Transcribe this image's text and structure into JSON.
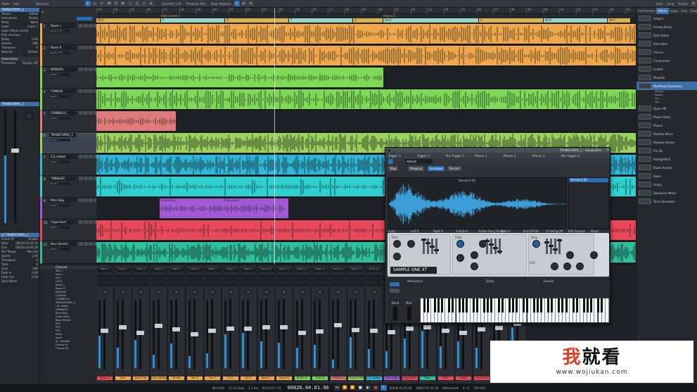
{
  "toolbar": {
    "mode": "Mute",
    "solo": "Solo",
    "standard": "Standard",
    "quantize": "Quantize",
    "timebase": "Timebase",
    "snap": "Snap",
    "quantize_val": "1/16",
    "timebase_val": "Bars",
    "snap_val": "Adaptive",
    "start": "Start",
    "song": "Song",
    "project": "Project"
  },
  "inspector": {
    "track_name": "TRANSFORM1_1",
    "rows": [
      {
        "k": "Tempo",
        "v": "Follow"
      },
      {
        "k": "Instrument",
        "v": "Drums"
      },
      {
        "k": "Mode",
        "v": "None"
      },
      {
        "k": "Layer",
        "v": "Layer 1"
      },
      {
        "k": "Layer follow events",
        "v": ""
      },
      {
        "k": "Play overlaps",
        "v": ""
      },
      {
        "k": "Delay",
        "v": "0.00"
      },
      {
        "k": "Volume",
        "v": "0dB"
      },
      {
        "k": "Transpose",
        "v": "0"
      },
      {
        "k": "Velocity",
        "v": "Default"
      }
    ],
    "automation_hdr": "Automation",
    "automation": "Parameter",
    "automation_val": "Display Off",
    "channel_name": "TRANSFORM1_1",
    "groups_hdr": "L1 TRANSFORM1_1",
    "groups": [
      {
        "k": "Event FX",
        "v": "Enable"
      },
      {
        "k": "Start",
        "v": "00026.02.01.25"
      },
      {
        "k": "End",
        "v": "00026.03.04.26"
      },
      {
        "k": "File Tempo",
        "v": "Not Set"
      },
      {
        "k": "Speed",
        "v": "1.00"
      },
      {
        "k": "Transpose",
        "v": "0"
      },
      {
        "k": "Tune",
        "v": "0"
      },
      {
        "k": "Gain",
        "v": "0dB"
      },
      {
        "k": "Fade In",
        "v": "0.00"
      },
      {
        "k": "Fade Out",
        "v": "0.00"
      },
      {
        "k": "Send Mode",
        "v": ""
      }
    ]
  },
  "ruler": [
    "13",
    "14",
    "15",
    "16",
    "17",
    "18",
    "19",
    "20",
    "21",
    "22",
    "23",
    "24",
    "25",
    "26",
    "27",
    "28",
    "29",
    "30",
    "31",
    "32",
    "33",
    "34",
    "35",
    "36",
    "37",
    "38",
    "39",
    "40",
    "41",
    "42",
    "43",
    "44",
    "45"
  ],
  "markers": [
    {
      "label": "Intro-Chord 1"
    },
    {
      "label": "Chorus 1"
    }
  ],
  "chords": [
    "Dm7",
    "F",
    "G",
    "F",
    "G",
    "Dm7",
    "G",
    "Am7",
    "Am7",
    "F",
    "G"
  ],
  "tracks": [
    {
      "num": "1",
      "name": "Room L",
      "input": "Input L+R",
      "color": "#f0a64a"
    },
    {
      "num": "2",
      "name": "Room R",
      "input": "Input L+R",
      "color": "#f0a64a"
    },
    {
      "num": "3",
      "name": "BONGOS",
      "input": "Input 1",
      "color": "#7ed957"
    },
    {
      "num": "4",
      "name": "CONGAS",
      "input": "Input 1",
      "color": "#7ed957"
    },
    {
      "num": "5",
      "name": "COWBELLS",
      "input": "Input 1",
      "color": "#e07b7b"
    },
    {
      "num": "6",
      "name": "TRANSFORM1_1",
      "input": "Input 1",
      "color": "#9bd35e"
    },
    {
      "num": "7",
      "name": "L1L shaker",
      "input": "Input 1",
      "color": "#2fb6d8"
    },
    {
      "num": "8",
      "name": "TIMBALES",
      "input": "Input 1",
      "color": "#2fd0d0"
    },
    {
      "num": "9",
      "name": "Rhm Slap",
      "input": "Input 1",
      "color": "#a15ad4"
    },
    {
      "num": "10",
      "name": "Claps Hard",
      "input": "Input 1",
      "color": "#e8485a"
    },
    {
      "num": "11",
      "name": "Bass Electric",
      "input": "Input 1",
      "color": "#2fbf9c"
    }
  ],
  "clip_labels": [
    "Percussion",
    "Percussion"
  ],
  "mixer": {
    "channel_hdr": "Channel",
    "list": [
      "Tom 1",
      "Tom 2",
      "OH L",
      "OH R",
      "Room L",
      "Room R",
      "BONGOS",
      "CONGAS",
      "COWBELLS",
      "TRANSFORM1_1",
      "L1L shaker",
      "TIMBALES",
      "Rhm Slap",
      "Claps Hard",
      "Bass Electric",
      "EP4",
      "EP2",
      "EP3",
      "Mello",
      "Vocal",
      "VL. sforzato",
      "Chorus VI",
      "Chorus VII"
    ],
    "strips": [
      {
        "io": "Input 1",
        "label": "Drum 1",
        "color": "#e8485a",
        "fader": 0.55,
        "meter": 0.48
      },
      {
        "io": "Input 2",
        "label": "Kick",
        "color": "#f0a64a",
        "fader": 0.6,
        "meter": 0.3
      },
      {
        "io": "Input 3",
        "label": "Snare Top",
        "color": "#f0a64a",
        "fader": 0.52,
        "meter": 0.42
      },
      {
        "io": "Input 4",
        "label": "Snare Bottom",
        "color": "#f0a64a",
        "fader": 0.62,
        "meter": 0.2
      },
      {
        "io": "Input 5",
        "label": "Hi-Hat",
        "color": "#f0a64a",
        "fader": 0.57,
        "meter": 0.36
      },
      {
        "io": "Input 6",
        "label": "Tom 1",
        "color": "#f0a64a",
        "fader": 0.5,
        "meter": 0.18
      },
      {
        "io": "Input 7",
        "label": "Tom 2",
        "color": "#f0a64a",
        "fader": 0.55,
        "meter": 0.22
      },
      {
        "io": "Input 8",
        "label": "OH L",
        "color": "#f0a64a",
        "fader": 0.58,
        "meter": 0.5
      },
      {
        "io": "Input 9",
        "label": "OH R",
        "color": "#f0a64a",
        "fader": 0.58,
        "meter": 0.52
      },
      {
        "io": "Input 10",
        "label": "Room L",
        "color": "#f0a64a",
        "fader": 0.6,
        "meter": 0.4
      },
      {
        "io": "Input 11",
        "label": "Room R",
        "color": "#f0a64a",
        "fader": 0.6,
        "meter": 0.38
      },
      {
        "io": "Input 12",
        "label": "BONGOS",
        "color": "#7ed957",
        "fader": 0.52,
        "meter": 0.3
      },
      {
        "io": "Input 13",
        "label": "CONGAS",
        "color": "#7ed957",
        "fader": 0.54,
        "meter": 0.34
      },
      {
        "io": "Input 14",
        "label": "COWBELLS",
        "color": "#e07b7b",
        "fader": 0.63,
        "meter": 0.12
      },
      {
        "io": "Input 15",
        "label": "TRANSFORM",
        "color": "#9bd35e",
        "fader": 0.56,
        "meter": 0.46
      },
      {
        "io": "Input 16",
        "label": "L1L shaker",
        "color": "#2fb6d8",
        "fader": 0.55,
        "meter": 0.28
      },
      {
        "io": "Input 17",
        "label": "Rhm Slap",
        "color": "#a15ad4",
        "fader": 0.53,
        "meter": 0.25
      },
      {
        "io": "Input 18",
        "label": "Claps Hard",
        "color": "#e8485a",
        "fader": 0.58,
        "meter": 0.44
      },
      {
        "io": "Input 19",
        "label": "Bass",
        "color": "#2fbf9c",
        "fader": 0.6,
        "meter": 0.55
      },
      {
        "io": "Input 20",
        "label": "EP4",
        "color": "#e8485a",
        "fader": 0.55,
        "meter": 0.32
      },
      {
        "io": "Input 21",
        "label": "Vocal",
        "color": "#e8485a",
        "fader": 0.52,
        "meter": 0.4
      },
      {
        "io": "Input 22",
        "label": "Chorus VI",
        "color": "#e8485a",
        "fader": 0.57,
        "meter": 0.3
      },
      {
        "io": "Input 23",
        "label": "Chorus VII",
        "color": "#e8485a",
        "fader": 0.59,
        "meter": 0.35
      },
      {
        "io": "Output",
        "label": "Main",
        "color": "#cfd3d8",
        "fader": 0.65,
        "meter": 0.6
      }
    ]
  },
  "browser": {
    "tabs": [
      "Instruments",
      "Effects",
      "Loops",
      "Files",
      "Cloud",
      "Pool"
    ],
    "items": [
      {
        "name": "Ampire"
      },
      {
        "name": "Analog Delay"
      },
      {
        "name": "Beat Delay"
      },
      {
        "name": "Bitcrusher"
      },
      {
        "name": "Chorus"
      },
      {
        "name": "Compressor"
      },
      {
        "name": "Limiter"
      },
      {
        "name": "Mixverb"
      },
      {
        "name": "Multiband Dynamics",
        "selected": true
      },
      {
        "name": "Open AIR"
      },
      {
        "name": "Phase Meter"
      },
      {
        "name": "Phaser"
      },
      {
        "name": "Pipeline Mono"
      },
      {
        "name": "Pipeline Stereo"
      },
      {
        "name": "Pro EQ"
      },
      {
        "name": "RedlightDist"
      },
      {
        "name": "Room Reverb"
      },
      {
        "name": "Rotor"
      },
      {
        "name": "Scope"
      },
      {
        "name": "Spectrum Meter"
      },
      {
        "name": "Tone Generator"
      }
    ],
    "sub": [
      "default",
      "Master",
      "Mix",
      "Tool"
    ]
  },
  "transport": {
    "sample_rate": "48.0 kHz",
    "record_time": "11:10 days",
    "performance": "1.1 ms",
    "timecode": "00:01:07.731",
    "bars": "00026.04.01.96",
    "loop_start": "00026.01.01.00",
    "loop_end": "00027.01.01.00",
    "tempo": "120.000",
    "signature": "4 / 4",
    "metronome": "Metronome"
  },
  "plugin": {
    "title": "TRANSFORM1_1 - SampleOne",
    "slots": [
      "Trigger 1",
      "Trigger 2",
      "Mix Trigger 3",
      "Phasor 1",
      "Phasor 2",
      "Phasor 3",
      "Mix Trigger 4"
    ],
    "preset": "default",
    "tabs": [
      "Map",
      "Mapping",
      "Envelope",
      "Record"
    ],
    "active_tab": "Envelope",
    "sample_name": "Version1 D1",
    "zone_hdr": "Version1 D1",
    "params": [
      "Loop",
      "Left 0",
      "Right 0",
      "X-Fade 0",
      "Follow Song Tempo",
      "Start 0",
      "End 39744",
      "Ui Retrig Off",
      "Edit Sample",
      "Reset"
    ],
    "sections": [
      "Pitch",
      "Filter",
      "Amp"
    ],
    "knob_labels": [
      "Transpose",
      "Tune",
      "Cutoff",
      "Res",
      "Drive",
      "Attack",
      "Decay",
      "Sustain",
      "Release",
      "Velocity",
      "Key Follow"
    ],
    "lfo": "LFO",
    "logo": "SAMPLE ONE XT",
    "mod": "Modulation",
    "delay": "Delay",
    "reverb": "Reverb",
    "bend": "Bend",
    "mod_wheel": "Mod"
  },
  "watermark": {
    "logo_a": "我",
    "logo_b": "就看",
    "url": "www.wojiukan.com"
  }
}
